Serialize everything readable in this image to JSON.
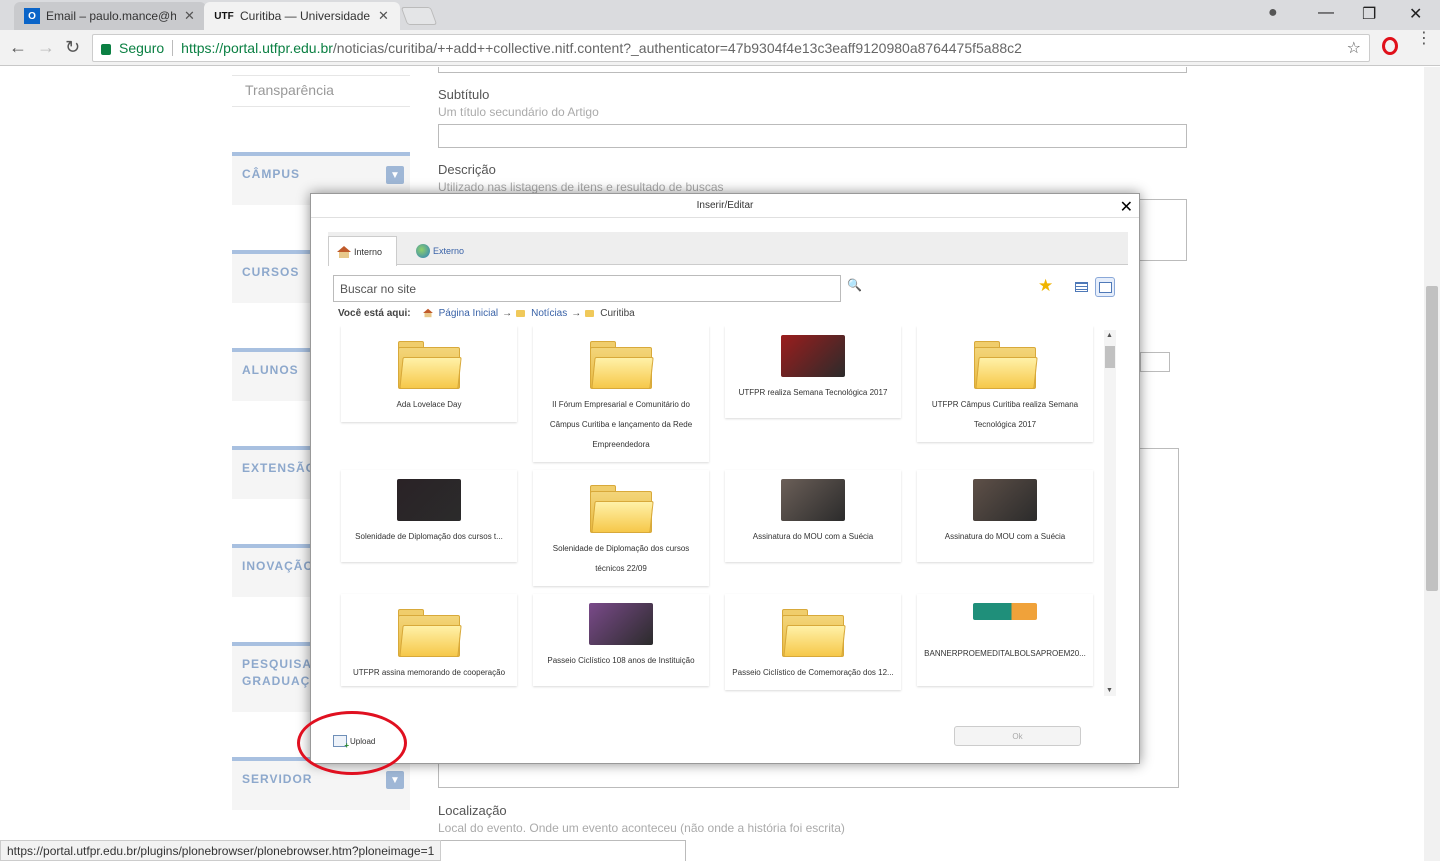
{
  "browser": {
    "tabs": [
      {
        "title": "Email – paulo.mance@hc",
        "close": "✕",
        "favicon": "O"
      },
      {
        "title": "Curitiba — Universidade",
        "close": "✕",
        "favicon": "UTF"
      }
    ],
    "window_controls": {
      "account": "●",
      "minimize": "—",
      "maximize": "❐",
      "close": "✕"
    },
    "nav": {
      "back": "←",
      "forward": "→",
      "reload": "↻"
    },
    "secure_label": "Seguro",
    "url_host": "https://portal.utfpr.edu.br",
    "url_path": "/noticias/curitiba/++add++collective.nitf.content?_authenticator=47b9304f4e13c3eaff9120980a8764475f5a88c2",
    "bookmark_star": "☆",
    "menu": "⋮",
    "status_url": "https://portal.utfpr.edu.br/plugins/plonebrowser/plonebrowser.htm?ploneimage=1"
  },
  "sidebar": {
    "top_link": "Transparência",
    "sections": [
      {
        "label": "CÂMPUS",
        "toggle": "▼"
      },
      {
        "label": "CURSOS",
        "toggle": ""
      },
      {
        "label": "ALUNOS",
        "toggle": ""
      },
      {
        "label": "EXTENSÃO",
        "toggle": ""
      },
      {
        "label": "INOVAÇÃO",
        "toggle": ""
      },
      {
        "label": "PESQUISA E PÓS-\nGRADUAÇÃO",
        "toggle": ""
      },
      {
        "label": "SERVIDOR",
        "toggle": "▼"
      }
    ]
  },
  "form": {
    "subtitle_label": "Subtítulo",
    "subtitle_help": "Um título secundário do Artigo",
    "description_label": "Descrição",
    "description_help": "Utilizado nas listagens de itens e resultado de buscas",
    "location_label": "Localização",
    "location_help": "Local do evento. Onde um evento aconteceu (não onde a história foi escrita)"
  },
  "modal": {
    "title": "Inserir/Editar",
    "close": "✕",
    "tabs": {
      "internal": "Interno",
      "external": "Externo"
    },
    "search_placeholder": "Buscar no site",
    "search_icon": "🔍",
    "favorite_icon": "★",
    "breadcrumb_lead": "Você está aqui:",
    "breadcrumbs": [
      "Página Inicial",
      "Notícias",
      "Curitiba"
    ],
    "arrow": "→",
    "upload_label": "Upload",
    "ok_label": "Ok",
    "items": [
      {
        "caption": "Ada Lovelace Day",
        "kind": "folder"
      },
      {
        "caption": "II Fórum Empresarial e Comunitário do Câmpus Curitiba e lançamento da Rede Empreendedora",
        "kind": "folder"
      },
      {
        "caption": "UTFPR realiza Semana Tecnológica 2017",
        "kind": "image",
        "color": "#9b1d1d"
      },
      {
        "caption": "UTFPR Câmpus Curitiba realiza Semana Tecnológica 2017",
        "kind": "folder"
      },
      {
        "caption": "Solenidade de Diplomação dos cursos t...",
        "kind": "image",
        "color": "#2a2226"
      },
      {
        "caption": "Solenidade de Diplomação dos cursos técnicos 22/09",
        "kind": "folder"
      },
      {
        "caption": "Assinatura do MOU com a Suécia",
        "kind": "image",
        "color": "#6b5f58"
      },
      {
        "caption": "Assinatura do MOU com a Suécia",
        "kind": "image",
        "color": "#5e5048"
      },
      {
        "caption": "UTFPR assina memorando de cooperação",
        "kind": "folder"
      },
      {
        "caption": "Passeio Ciclístico 108 anos de Instituição",
        "kind": "image",
        "color": "#7a4a8a"
      },
      {
        "caption": "Passeio Ciclístico de Comemoração dos 12...",
        "kind": "folder"
      },
      {
        "caption": "BANNERPROEMEDITALBOLSAPROEM20...",
        "kind": "banner",
        "color": "#1f8f7a"
      }
    ]
  }
}
